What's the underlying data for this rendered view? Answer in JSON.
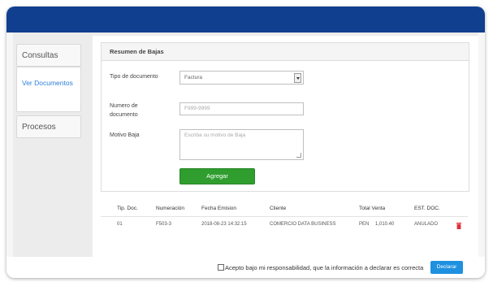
{
  "sidebar": {
    "items": [
      {
        "label": "Consultas"
      },
      {
        "label": "Ver Documentos"
      },
      {
        "label": "Procesos"
      }
    ]
  },
  "panel": {
    "title": "Resumen de Bajas",
    "tipo_label": "Tipo de documento",
    "tipo_value": "Factura",
    "numero_label": "Numero de documento",
    "numero_placeholder": "F999-9999",
    "motivo_label": "Motivo Baja",
    "motivo_placeholder": "Escriba su motivo de Baja",
    "agregar_label": "Agregar"
  },
  "table": {
    "headers": [
      "Tip. Doc.",
      "Numeración",
      "Fecha Emision",
      "Cliente",
      "Total Venta",
      "EST. DOC."
    ],
    "rows": [
      {
        "tip_doc": "01",
        "numeracion": "F503-3",
        "fecha": "2018-08-23 14:32:15",
        "cliente": "COMERCIO DATA BUSINESS",
        "moneda": "PEN",
        "total": "1,010.40",
        "estado": "ANULADO"
      }
    ]
  },
  "footer": {
    "accept_text": "Acepto bajo mi responsabilidad, que la información a declarar es correcta",
    "declarar_label": "Declarar"
  },
  "colors": {
    "topbar": "#0f3f8e",
    "agregar": "#2f9e2f",
    "declarar": "#1e90e0",
    "trash": "#e0303a",
    "link": "#2e7fd6"
  }
}
